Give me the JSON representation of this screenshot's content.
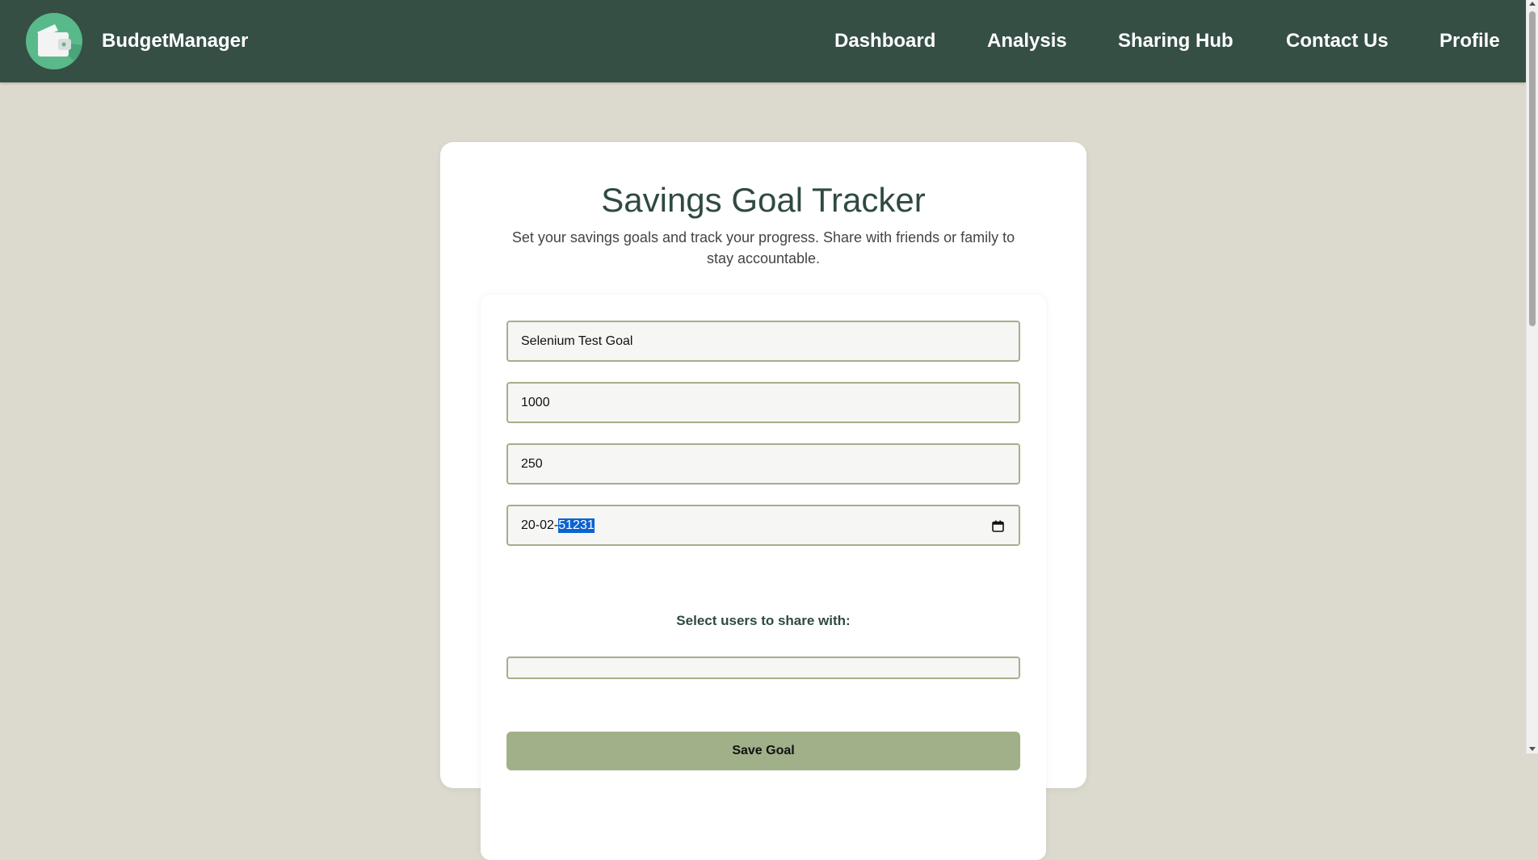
{
  "app": {
    "brand": "BudgetManager"
  },
  "nav": {
    "items": [
      {
        "label": "Dashboard"
      },
      {
        "label": "Analysis"
      },
      {
        "label": "Sharing Hub"
      },
      {
        "label": "Contact Us"
      },
      {
        "label": "Profile"
      }
    ]
  },
  "page": {
    "title": "Savings Goal Tracker",
    "subtitle": "Set your savings goals and track your progress. Share with friends or family to stay accountable."
  },
  "form": {
    "goal_name": "Selenium Test Goal",
    "target_amount": "1000",
    "current_amount": "250",
    "date_prefix": "20-02-",
    "date_selected": "51231",
    "share_label": "Select users to share with:",
    "share_selected": "",
    "save_label": "Save Goal"
  },
  "colors": {
    "navbar": "#354f45",
    "background": "#dcdace",
    "accent": "#a0b089",
    "field_border": "#a4af8a",
    "logo": "#59b98a"
  },
  "icons": {
    "logo": "wallet-icon",
    "date": "calendar-icon"
  }
}
